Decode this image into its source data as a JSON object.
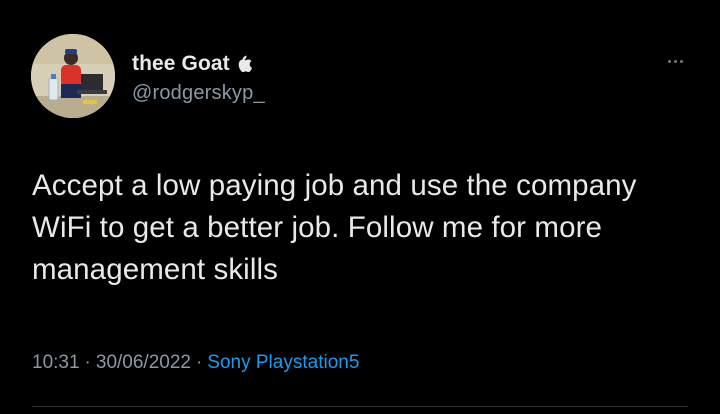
{
  "tweet": {
    "author": {
      "display_name": "thee Goat",
      "badge_icon": "apple-icon",
      "handle": "@rodgerskyp_"
    },
    "more_icon": "more-horizontal-icon",
    "text": "Accept a low paying job and use the company WiFi to get a better job. Follow me for more  management skills",
    "time": "10:31",
    "separator": "·",
    "date": "30/06/2022",
    "source": "Sony Playstation5"
  },
  "colors": {
    "background": "#000000",
    "primary_text": "#e7e9ea",
    "secondary_text": "#8b98a5",
    "link": "#1d9bf0",
    "divider": "#2f3336"
  }
}
